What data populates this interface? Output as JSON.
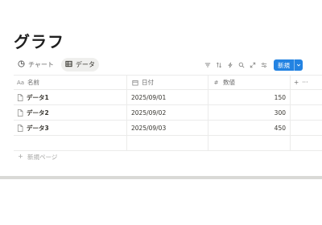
{
  "page": {
    "title": "グラフ"
  },
  "views": [
    {
      "label": "チャート",
      "icon": "chart-icon",
      "active": false
    },
    {
      "label": "データ",
      "icon": "table-icon",
      "active": true
    }
  ],
  "toolbar": {
    "icons": [
      "filter-icon",
      "sort-icon",
      "lightning-icon",
      "search-icon",
      "expand-icon",
      "settings-icon"
    ],
    "new_label": "新規",
    "accent": "#2383e2"
  },
  "table": {
    "columns": [
      {
        "label": "名前",
        "icon": "Aa"
      },
      {
        "label": "日付",
        "icon": "calendar-icon"
      },
      {
        "label": "数値",
        "icon": "#"
      }
    ],
    "add_column": "+",
    "more": "···",
    "rows": [
      {
        "name": "データ1",
        "date": "2025/09/01",
        "value": "150"
      },
      {
        "name": "データ2",
        "date": "2025/09/02",
        "value": "300"
      },
      {
        "name": "データ3",
        "date": "2025/09/03",
        "value": "450"
      }
    ],
    "new_page_label": "新規ページ"
  }
}
